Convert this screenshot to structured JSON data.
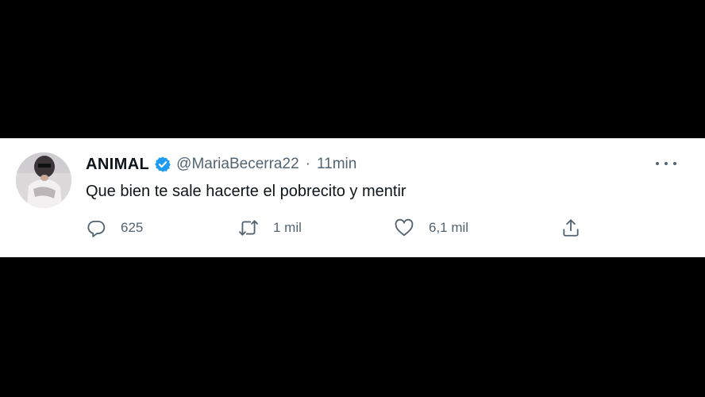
{
  "tweet": {
    "display_name": "ANIMAL",
    "handle": "@MariaBecerra22",
    "separator": "·",
    "time": "11min",
    "text": "Que bien te sale hacerte el pobrecito y mentir",
    "verified": true,
    "actions": {
      "reply_count": "625",
      "retweet_count": "1 mil",
      "like_count": "6,1 mil"
    },
    "icons": {
      "reply": "reply-icon",
      "retweet": "retweet-icon",
      "like": "heart-icon",
      "share": "share-icon",
      "more": "more-icon",
      "verified": "verified-badge-icon"
    },
    "colors": {
      "verified": "#1d9bf0",
      "text": "#0f1419",
      "secondary": "#536471",
      "background": "#ffffff",
      "frame": "#000000"
    }
  }
}
